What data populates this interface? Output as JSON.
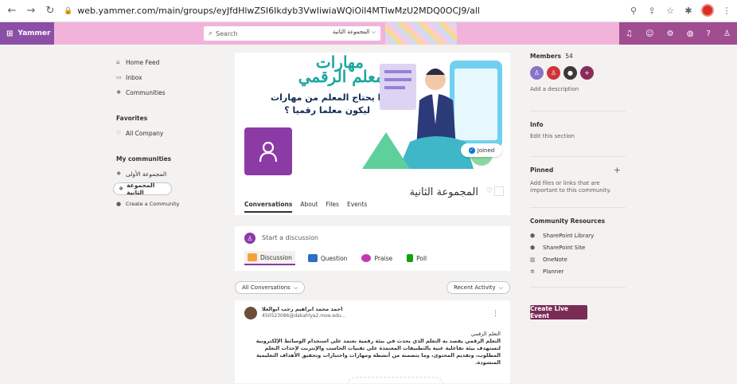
{
  "browser": {
    "url": "web.yammer.com/main/groups/eyJfdHlwZSI6Ikdyb3VwIiwiaWQiOiI4MTIwMzU2MDQ0OCJ9/all"
  },
  "topbar": {
    "brand": "Yammer",
    "search_placeholder": "Search",
    "search_scope": "المجموعة الثانية"
  },
  "leftnav": {
    "items": [
      {
        "label": "Home Feed",
        "icon": "home-icon"
      },
      {
        "label": "Inbox",
        "icon": "inbox-icon"
      },
      {
        "label": "Communities",
        "icon": "communities-icon"
      }
    ],
    "favorites_heading": "Favorites",
    "favorites": [
      {
        "label": "All Company"
      }
    ],
    "my_communities_heading": "My communities",
    "communities": [
      {
        "label": "المجموعة الأولى"
      },
      {
        "label": "المجموعة الثانية"
      }
    ],
    "create_label": "Create a Community"
  },
  "group": {
    "banner_line1": "مهارات",
    "banner_line2": "المعلم الرقمي",
    "banner_line3": "ماذا يحتاج المعلم من مهارات",
    "banner_line4": "ليكون معلما رقميا ؟",
    "joined_label": "Joined",
    "title": "المجموعة الثانية",
    "tabs": [
      "Conversations",
      "About",
      "Files",
      "Events"
    ]
  },
  "publisher": {
    "placeholder": "Start a discussion",
    "tools": [
      "Discussion",
      "Question",
      "Praise",
      "Poll"
    ]
  },
  "filters": {
    "left": "All Conversations",
    "right": "Recent Activity"
  },
  "post": {
    "author": "احمد محمد ابراهيم رجب ابوالعلا",
    "email": "450523086@dakahlya2.moe.edu...",
    "title": "التعلم الرقمي",
    "body": "التعلم الرقمي يقصد به التعلم الذي يحدث في بيئة رقمية تعتمد على استخدام الوسائط الإلكترونية لتستهدف بيئة تفاعلية غنية بالتطبيقات المعتمدة على تقنيات الحاسب والإنترنت لإحداث التعلم المطلوب، وتقديم المحتوى، وما يتضمنه من أنشطة ومهارات واختبارات وتحقيق الأهداف التعليمية المنشودة."
  },
  "right": {
    "members_label": "Members",
    "members_count": "54",
    "add_description": "Add a description",
    "info_heading": "Info",
    "info_sub": "Edit this section",
    "pinned_heading": "Pinned",
    "pinned_add": "+",
    "pinned_sub": "Add files or links that are important to this community.",
    "resources_heading": "Community Resources",
    "resources": [
      {
        "label": "SharePoint Library"
      },
      {
        "label": "SharePoint Site"
      },
      {
        "label": "OneNote"
      },
      {
        "label": "Planner"
      }
    ],
    "live_event_label": "Create Live Event"
  },
  "colors": {
    "topbar": "#f2b3db",
    "brand": "#8c4fa8",
    "accent_purple": "#8c3aa6",
    "live_event": "#7a2c57"
  }
}
